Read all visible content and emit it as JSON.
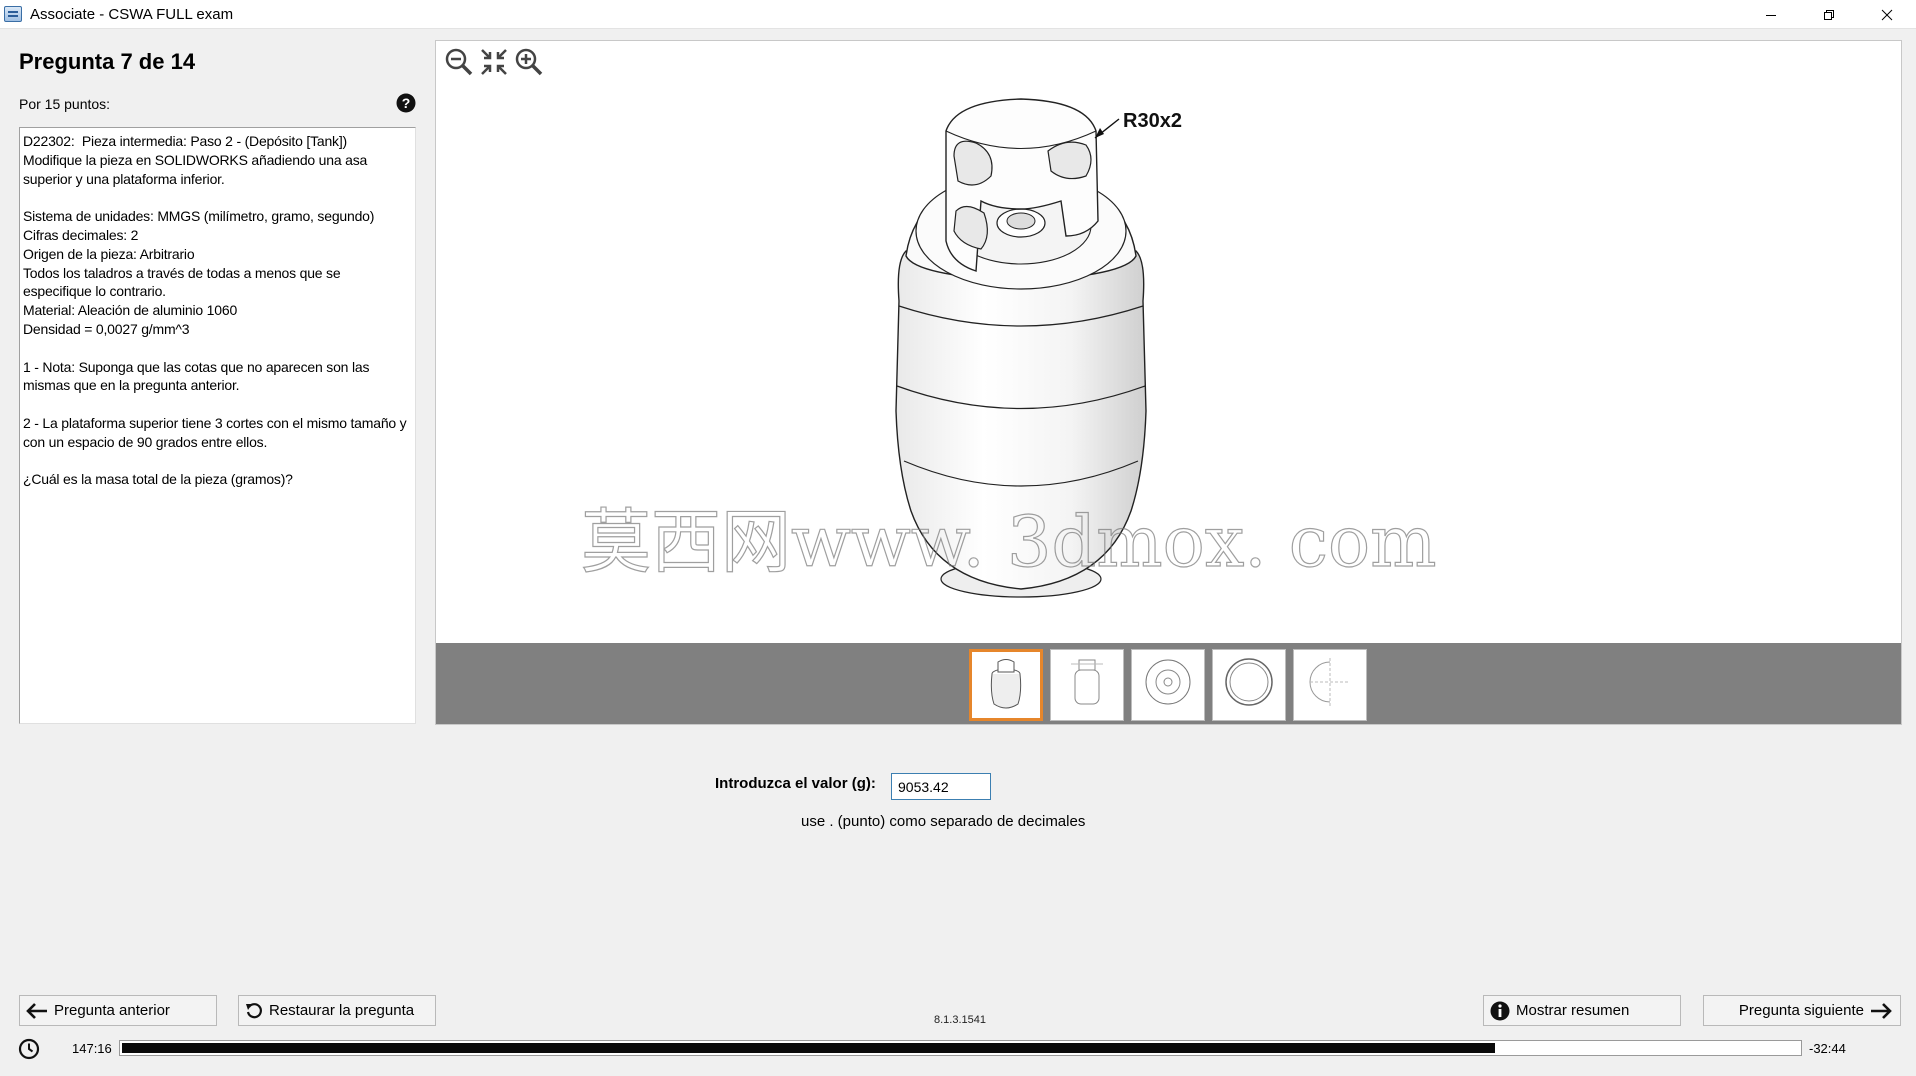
{
  "window": {
    "title": "Associate - CSWA FULL exam",
    "icon": "app-icon",
    "controls": [
      "minimize-icon",
      "restore-icon",
      "close-icon"
    ]
  },
  "question": {
    "title": "Pregunta 7 de 14",
    "points": "Por 15 puntos:",
    "help_icon": "help-icon",
    "text": "D22302:  Pieza intermedia: Paso 2 - (Depósito [Tank])\nModifique la pieza en SOLIDWORKS añadiendo una asa superior y una plataforma inferior.\n\nSistema de unidades: MMGS (milímetro, gramo, segundo)\nCifras decimales: 2\nOrigen de la pieza: Arbitrario\nTodos los taladros a través de todas a menos que se especifique lo contrario.\nMaterial: Aleación de aluminio 1060\nDensidad = 0,0027 g/mm^3\n\n1 - Nota: Suponga que las cotas que no aparecen son las mismas que en la pregunta anterior.\n\n2 - La plataforma superior tiene 3 cortes con el mismo tamaño y con un espacio de 90 grados entre ellos.\n\n¿Cuál es la masa total de la pieza (gramos)?"
  },
  "viewer": {
    "tools": [
      "zoom-out-icon",
      "fit-icon",
      "zoom-in-icon"
    ],
    "annotation": "R30x2",
    "watermark": "莫西网www. 3dmox. com",
    "thumbnails_count": 5,
    "active_thumbnail": 1,
    "accent_color": "#e6862b"
  },
  "answer": {
    "label": "Introduzca el valor (g):",
    "value": "9053.42",
    "hint": "use . (punto) como separado de decimales"
  },
  "buttons": {
    "prev": "Pregunta anterior",
    "restore": "Restaurar la pregunta",
    "summary": "Mostrar resumen",
    "next": "Pregunta siguiente"
  },
  "version": "8.1.3.1541",
  "timer": {
    "elapsed": "147:16",
    "remaining": "-32:44",
    "progress_fraction": 0.8187
  }
}
